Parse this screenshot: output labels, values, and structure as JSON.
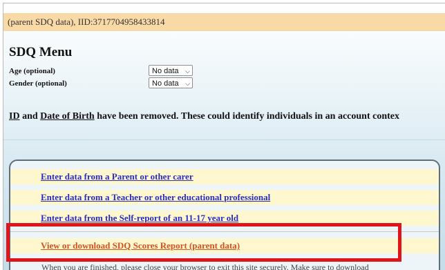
{
  "banner": {
    "text": "(parent SDQ data), IID:3717704958433814"
  },
  "menu": {
    "title": "SDQ Menu",
    "age_label": "Age (optional)",
    "age_value": "No data",
    "gender_label": "Gender (optional)",
    "gender_value": "No data"
  },
  "notice": {
    "id_text": "ID",
    "and_text": " and ",
    "dob_text": "Date of Birth",
    "rest_text": " have been removed. These could identify individuals in an account contex"
  },
  "links": [
    {
      "label": "Enter data from a Parent or other carer"
    },
    {
      "label": "Enter data from a Teacher or other educational professional"
    },
    {
      "label": "Enter data from the Self-report of an 11-17 year old"
    },
    {
      "label": "View or download SDQ Scores Report (parent data)"
    }
  ],
  "footer": {
    "text": "When you are finished, please close your browser to exit this site securely. Make sure to download"
  },
  "colors": {
    "highlight": "#e0141b",
    "link": "#2a2cc0",
    "report_link": "#d3521f",
    "banner": "#f9d9a6"
  }
}
